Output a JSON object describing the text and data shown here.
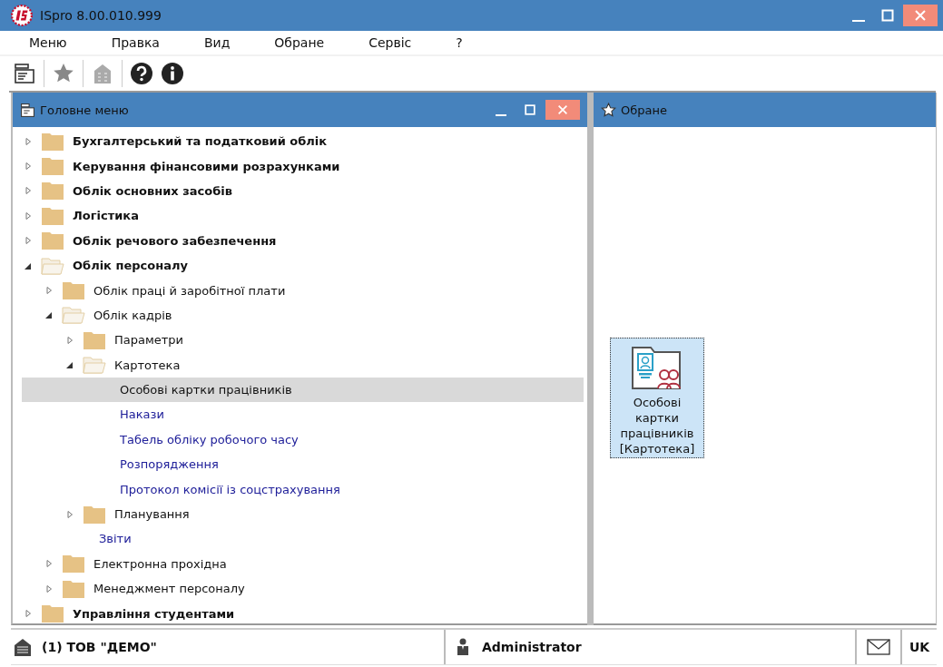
{
  "window": {
    "title": "ISpro 8.00.010.999"
  },
  "menu": [
    "Меню",
    "Правка",
    "Вид",
    "Обране",
    "Сервіс",
    "?"
  ],
  "main_pane": {
    "title": "Головне меню",
    "tree": [
      {
        "kind": "folder",
        "label": "Бухгалтерський та податковий облік",
        "expanded": false
      },
      {
        "kind": "folder",
        "label": "Керування фінансовими розрахунками",
        "expanded": false
      },
      {
        "kind": "folder",
        "label": "Облік основних засобів",
        "expanded": false
      },
      {
        "kind": "folder",
        "label": "Логістика",
        "expanded": false
      },
      {
        "kind": "folder",
        "label": "Облік речового забезпечення",
        "expanded": false
      },
      {
        "kind": "folder",
        "label": "Облік персоналу",
        "expanded": true,
        "children": [
          {
            "kind": "folder",
            "label": "Облік праці й заробітної плати",
            "expanded": false
          },
          {
            "kind": "folder",
            "label": "Облік кадрів",
            "expanded": true,
            "children": [
              {
                "kind": "folder",
                "label": "Параметри",
                "expanded": false
              },
              {
                "kind": "folder",
                "label": "Картотека",
                "expanded": true,
                "children": [
                  {
                    "kind": "item",
                    "label": "Особові картки працівників",
                    "selected": true
                  },
                  {
                    "kind": "item",
                    "label": "Накази",
                    "selected": false
                  },
                  {
                    "kind": "item",
                    "label": "Табель обліку робочого часу",
                    "selected": false
                  },
                  {
                    "kind": "item",
                    "label": "Розпорядження",
                    "selected": false
                  },
                  {
                    "kind": "item",
                    "label": "Протокол комісії із соцстрахування",
                    "selected": false
                  }
                ]
              },
              {
                "kind": "folder",
                "label": "Планування",
                "expanded": false
              },
              {
                "kind": "item",
                "label": "Звіти",
                "selected": false
              }
            ]
          },
          {
            "kind": "folder",
            "label": "Електронна прохідна",
            "expanded": false
          },
          {
            "kind": "folder",
            "label": "Менеджмент персоналу",
            "expanded": false
          }
        ]
      },
      {
        "kind": "folder",
        "label": "Управління студентами",
        "expanded": false
      }
    ]
  },
  "favorites_pane": {
    "title": "Обране",
    "shortcuts": [
      {
        "label": "Особові картки працівників [Картотека]",
        "selected": true
      }
    ]
  },
  "status_bar": {
    "company": "(1) ТОВ \"ДЕМО\"",
    "user": "Administrator",
    "language": "UK"
  }
}
